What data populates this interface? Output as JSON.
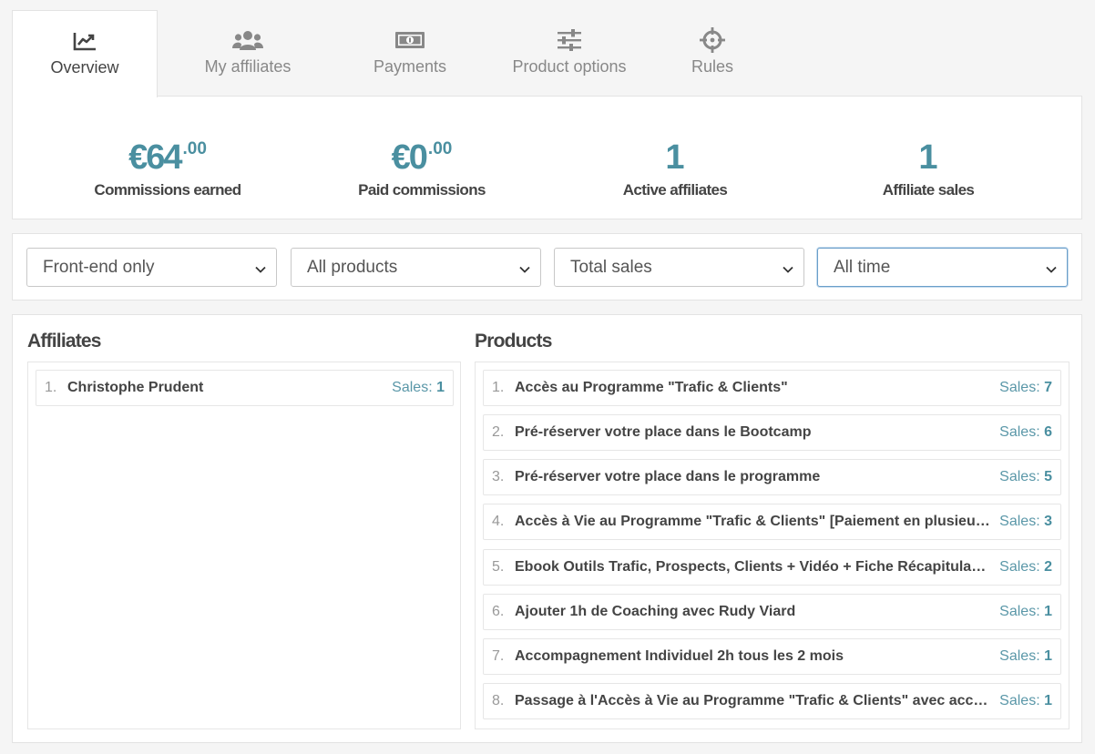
{
  "tabs": [
    {
      "label": "Overview",
      "icon": "chart-line-icon"
    },
    {
      "label": "My affiliates",
      "icon": "users-icon"
    },
    {
      "label": "Payments",
      "icon": "money-bill-icon"
    },
    {
      "label": "Product options",
      "icon": "sliders-icon"
    },
    {
      "label": "Rules",
      "icon": "crosshair-icon"
    }
  ],
  "stats": [
    {
      "value": "€64",
      "cents": ".00",
      "label": "Commissions earned"
    },
    {
      "value": "€0",
      "cents": ".00",
      "label": "Paid commissions"
    },
    {
      "value": "1",
      "cents": "",
      "label": "Active affiliates"
    },
    {
      "value": "1",
      "cents": "",
      "label": "Affiliate sales"
    }
  ],
  "filters": [
    {
      "selected": "Front-end only"
    },
    {
      "selected": "All products"
    },
    {
      "selected": "Total sales"
    },
    {
      "selected": "All time"
    }
  ],
  "affiliates": {
    "title": "Affiliates",
    "sales_label": "Sales:",
    "items": [
      {
        "num": "1.",
        "name": "Christophe Prudent",
        "sales": "1"
      }
    ]
  },
  "products": {
    "title": "Products",
    "sales_label": "Sales:",
    "items": [
      {
        "num": "1.",
        "name": "Accès au Programme \"Trafic & Clients\"",
        "sales": "7"
      },
      {
        "num": "2.",
        "name": "Pré-réserver votre place dans le Bootcamp",
        "sales": "6"
      },
      {
        "num": "3.",
        "name": "Pré-réserver votre place dans le programme",
        "sales": "5"
      },
      {
        "num": "4.",
        "name": "Accès à Vie au Programme \"Trafic & Clients\" [Paiement en plusieurs fois]",
        "sales": "3"
      },
      {
        "num": "5.",
        "name": "Ebook Outils Trafic, Prospects, Clients + Vidéo + Fiche Récapitulative",
        "sales": "2"
      },
      {
        "num": "6.",
        "name": "Ajouter 1h de Coaching avec Rudy Viard",
        "sales": "1"
      },
      {
        "num": "7.",
        "name": "Accompagnement Individuel 2h tous les 2 mois",
        "sales": "1"
      },
      {
        "num": "8.",
        "name": "Passage à l'Accès à Vie au Programme \"Trafic & Clients\" avec accompagnement",
        "sales": "1"
      }
    ]
  },
  "colors": {
    "accent": "#4a8fa0",
    "text": "#444444",
    "muted": "#888888"
  }
}
